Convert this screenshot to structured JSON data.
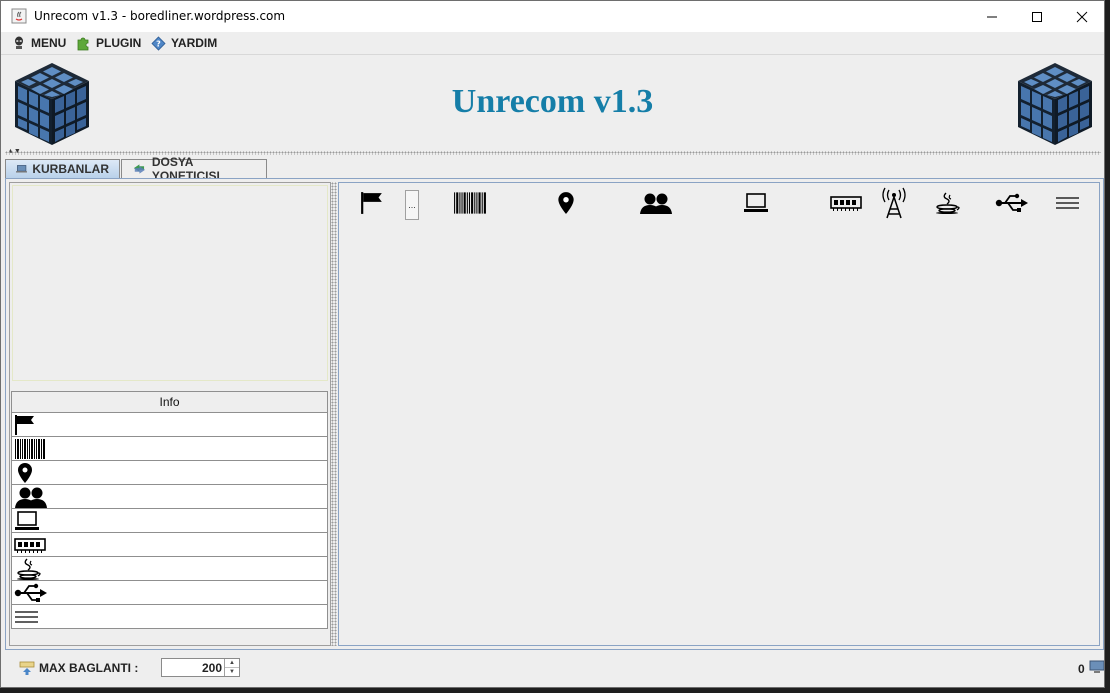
{
  "window": {
    "title": "Unrecom v1.3 - boredliner.wordpress.com"
  },
  "menu": [
    {
      "label": "MENU",
      "icon": "alien-icon"
    },
    {
      "label": "PLUGIN",
      "icon": "puzzle-icon"
    },
    {
      "label": "YARDIM",
      "icon": "help-diamond-icon"
    }
  ],
  "header": {
    "title": "Unrecom v1.3"
  },
  "tabs": [
    {
      "label": "KURBANLAR",
      "icon": "monitor-icon",
      "active": true
    },
    {
      "label": "DOSYA YONETICISI",
      "icon": "folder-transfer-icon",
      "active": false
    }
  ],
  "left_panel": {
    "info_header": "Info",
    "info_rows": [
      "flag-icon",
      "barcode-icon",
      "location-pin-icon",
      "users-icon",
      "laptop-icon",
      "ram-icon",
      "java-icon",
      "usb-icon",
      "menu-lines-icon"
    ]
  },
  "right_panel": {
    "columns": [
      "flag-icon",
      "barcode-icon",
      "location-pin-icon",
      "users-icon",
      "laptop-icon",
      "ram-icon",
      "antenna-icon",
      "java-icon",
      "usb-icon",
      "menu-lines-icon"
    ],
    "ellipsis_label": "..."
  },
  "status": {
    "max_label": "MAX BAGLANTI :",
    "max_value": "200",
    "connection_count": "0"
  },
  "colors": {
    "title_blue": "#157ea8",
    "tab_active": "#b9d1ea",
    "border_blue": "#8aa3c4"
  }
}
